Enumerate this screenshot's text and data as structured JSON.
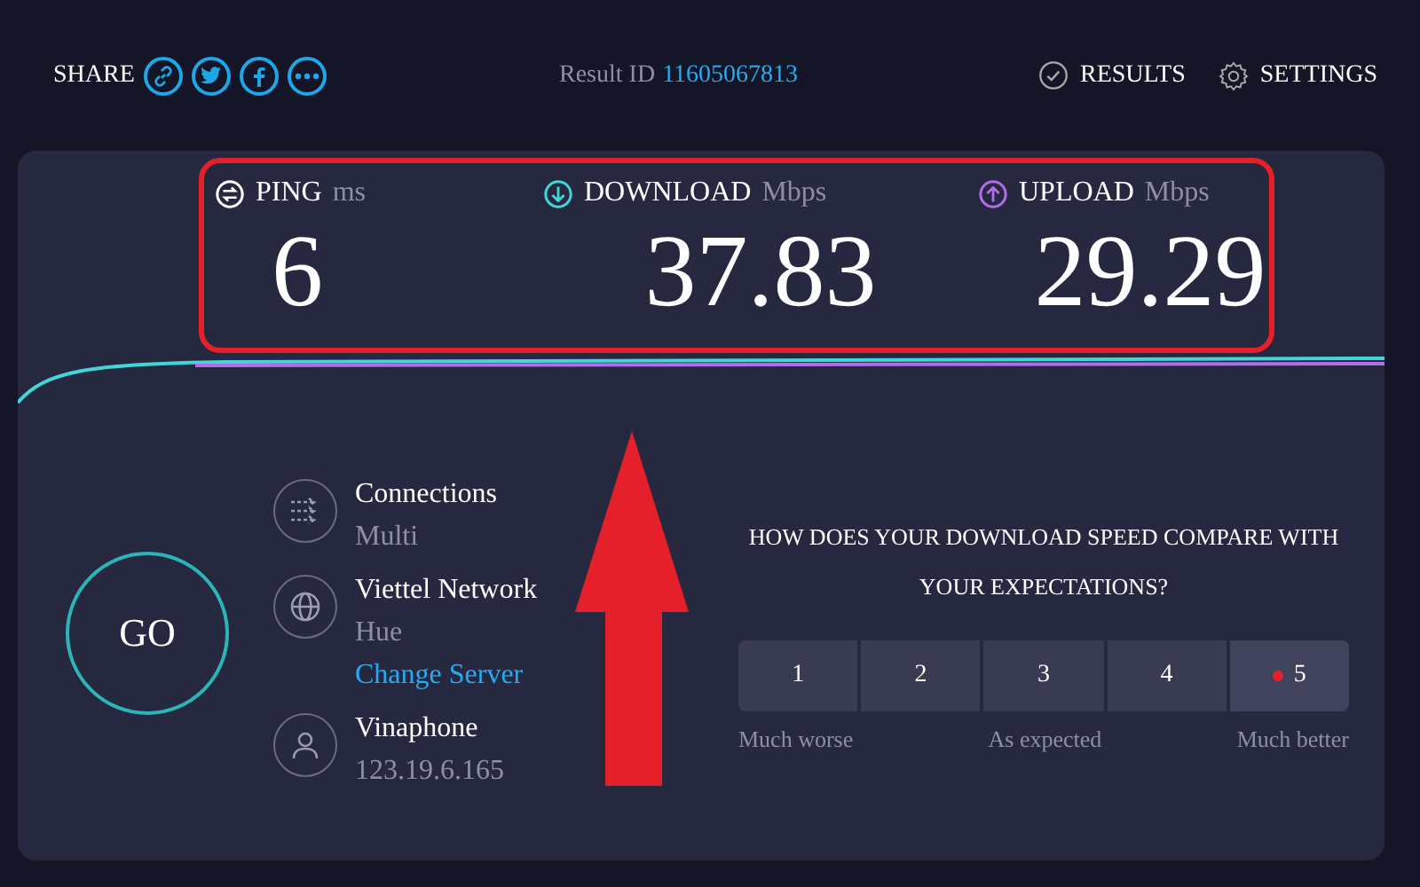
{
  "header": {
    "share_label": "SHARE",
    "result_id_label": "Result ID",
    "result_id": "11605067813",
    "results_label": "RESULTS",
    "settings_label": "SETTINGS"
  },
  "metrics": [
    {
      "kind": "ping",
      "label": "PING",
      "unit": "ms",
      "value": "6"
    },
    {
      "kind": "download",
      "label": "DOWNLOAD",
      "unit": "Mbps",
      "value": "37.83"
    },
    {
      "kind": "upload",
      "label": "UPLOAD",
      "unit": "Mbps",
      "value": "29.29"
    }
  ],
  "go_button": "GO",
  "info": [
    {
      "kind": "connections",
      "title": "Connections",
      "detail": "Multi"
    },
    {
      "kind": "server",
      "title": "Viettel Network",
      "detail": "Hue",
      "link": "Change Server"
    },
    {
      "kind": "provider",
      "title": "Vinaphone",
      "detail": "123.19.6.165"
    }
  ],
  "survey": {
    "question": "HOW DOES YOUR DOWNLOAD SPEED COMPARE WITH YOUR EXPECTATIONS?",
    "options": [
      {
        "label": "1",
        "selected": false
      },
      {
        "label": "2",
        "selected": false
      },
      {
        "label": "3",
        "selected": false
      },
      {
        "label": "4",
        "selected": false
      },
      {
        "label": "5",
        "selected": true
      }
    ],
    "scale_labels": [
      "Much worse",
      "As expected",
      "Much better"
    ]
  }
}
